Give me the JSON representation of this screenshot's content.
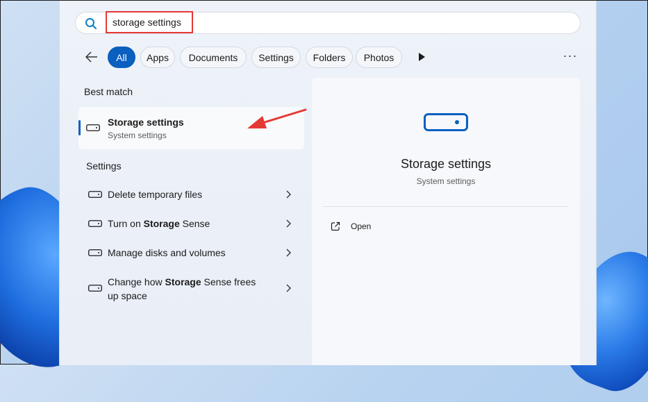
{
  "search": {
    "value": "storage settings"
  },
  "filters": {
    "chips": [
      {
        "label": "All",
        "active": true
      },
      {
        "label": "Apps",
        "active": false
      },
      {
        "label": "Documents",
        "active": false
      },
      {
        "label": "Settings",
        "active": false
      },
      {
        "label": "Folders",
        "active": false
      },
      {
        "label": "Photos",
        "active": false
      }
    ],
    "more_label": "···"
  },
  "best_match": {
    "heading": "Best match",
    "title": "Storage settings",
    "subtitle": "System settings"
  },
  "settings_section": {
    "heading": "Settings",
    "items": [
      {
        "label": "Delete temporary files"
      },
      {
        "label": "Turn on Storage Sense"
      },
      {
        "label": "Manage disks and volumes"
      },
      {
        "label": "Change how Storage Sense frees up space"
      }
    ]
  },
  "detail": {
    "title": "Storage settings",
    "subtitle": "System settings",
    "action_open": "Open"
  },
  "colors": {
    "accent": "#0a5fbf",
    "annotation": "#e53935"
  },
  "icons": [
    "search-icon",
    "back-arrow-icon",
    "play-icon",
    "more-icon",
    "drive-icon",
    "chevron-right-icon",
    "open-external-icon"
  ]
}
